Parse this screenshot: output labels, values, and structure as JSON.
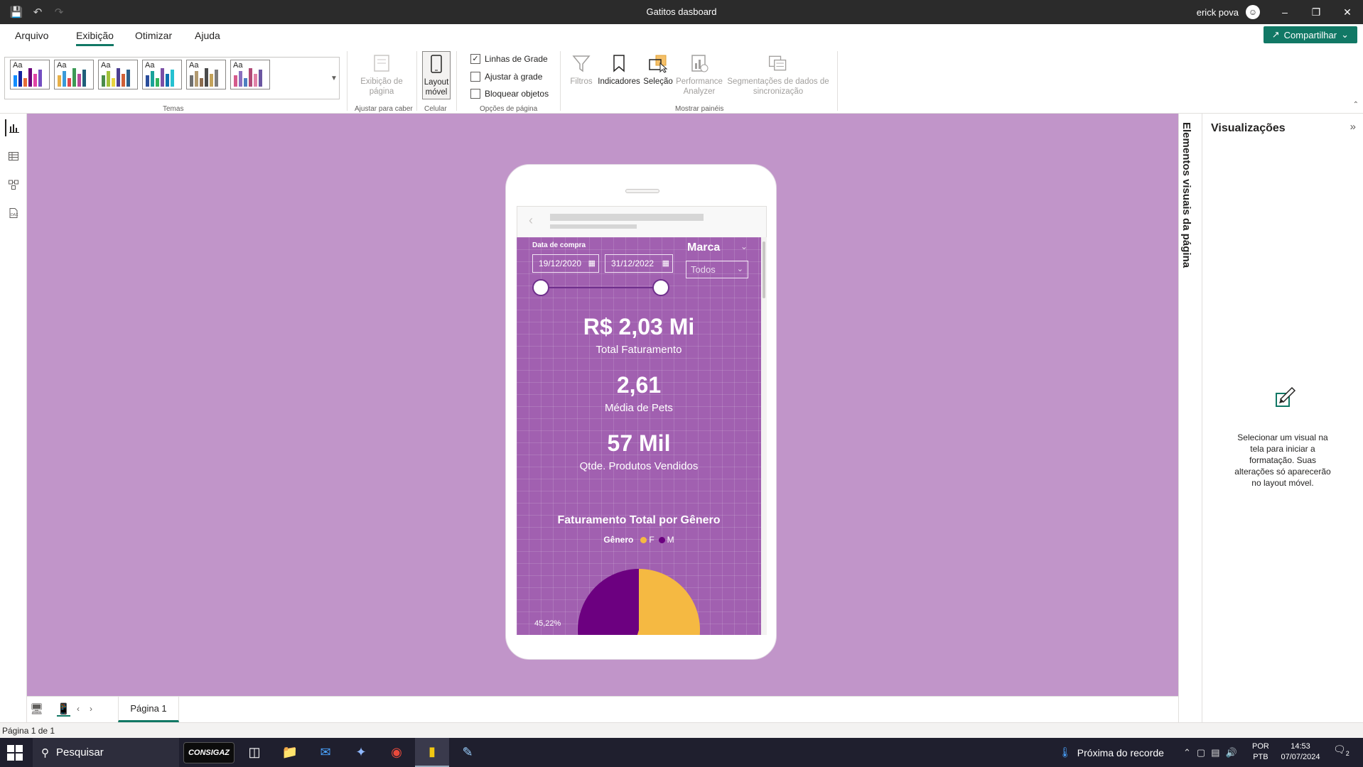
{
  "window": {
    "title": "Gatitos dasboard",
    "user": "erick pova",
    "avatar_icon": "account-circle-icon"
  },
  "menu": {
    "tabs": [
      "Arquivo",
      "Exibição",
      "Otimizar",
      "Ajuda"
    ],
    "active": "Exibição",
    "share_label": "Compartilhar"
  },
  "ribbon": {
    "themes_label": "Temas",
    "theme_preview_text": "Aa",
    "themes": [
      {
        "colors": [
          "#118dff",
          "#12239e",
          "#e66c37",
          "#6b007b",
          "#e044a7",
          "#744ec2"
        ]
      },
      {
        "colors": [
          "#e8b047",
          "#3b9ad9",
          "#e0474c",
          "#3c9a55",
          "#b7499a",
          "#1f5f7a"
        ]
      },
      {
        "colors": [
          "#4a8c4a",
          "#a2c139",
          "#e8d43f",
          "#4b3e92",
          "#d06037",
          "#2a5f8a"
        ]
      },
      {
        "colors": [
          "#2a4d9b",
          "#1aa29a",
          "#33b35a",
          "#7b4fa6",
          "#0e6fb0",
          "#25c1d1"
        ]
      },
      {
        "colors": [
          "#6e6e6e",
          "#b29a70",
          "#8c6c4e",
          "#4a4a4a",
          "#c4a35a",
          "#7d7d7d"
        ]
      },
      {
        "colors": [
          "#d45a8c",
          "#8a6fbf",
          "#4e7fc0",
          "#b04a77",
          "#e083a8",
          "#6b56a1"
        ]
      }
    ],
    "page_view_label": "Exibição de página",
    "fit_label": "Ajustar para caber",
    "mobile_label": "Layout móvel",
    "phone_label": "Celular",
    "gridlines_label": "Linhas de Grade",
    "snap_label": "Ajustar à grade",
    "lock_label": "Bloquear objetos",
    "page_options_label": "Opções de página",
    "filters_label": "Filtros",
    "bookmarks_label": "Indicadores",
    "selection_label": "Seleção",
    "performance_label": "Performance Analyzer",
    "sync_label": "Segmentações de dados de sincronização",
    "show_panes_label": "Mostrar painéis",
    "gridlines_checked": true,
    "snap_checked": false,
    "lock_checked": false
  },
  "report": {
    "slicer_title": "Data de compra",
    "date_start": "19/12/2020",
    "date_end": "31/12/2022",
    "slider_range": [
      0,
      1
    ],
    "marca_title": "Marca",
    "marca_value": "Todos",
    "kpis": [
      {
        "value": "R$ 2,03 Mi",
        "label": "Total Faturamento"
      },
      {
        "value": "2,61",
        "label": "Média de Pets"
      },
      {
        "value": "57 Mil",
        "label": "Qtde. Produtos Vendidos"
      }
    ],
    "background_color": "#a160b0"
  },
  "chart_data": {
    "type": "pie",
    "title": "Faturamento Total por Gênero",
    "legend_title": "Gênero",
    "legend_position": "top",
    "categories": [
      "F",
      "M"
    ],
    "values": [
      54.78,
      45.22
    ],
    "colors": [
      "#f5b942",
      "#6c0080"
    ],
    "data_labels": [
      "",
      "45,22%"
    ]
  },
  "visualizations": {
    "strip_label": "Elementos visuais da página",
    "title": "Visualizações",
    "message": "Selecionar um visual na tela para iniciar a formatação. Suas alterações só aparecerão no layout móvel."
  },
  "pages": {
    "tab": "Página 1",
    "status": "Página 1 de 1"
  },
  "taskbar": {
    "search_placeholder": "Pesquisar",
    "consigaz": "CONSIGAZ",
    "weather": "Próxima do recorde",
    "lang_line1": "POR",
    "lang_line2": "PTB",
    "time": "14:53",
    "date": "07/07/2024",
    "notifications": "2"
  }
}
